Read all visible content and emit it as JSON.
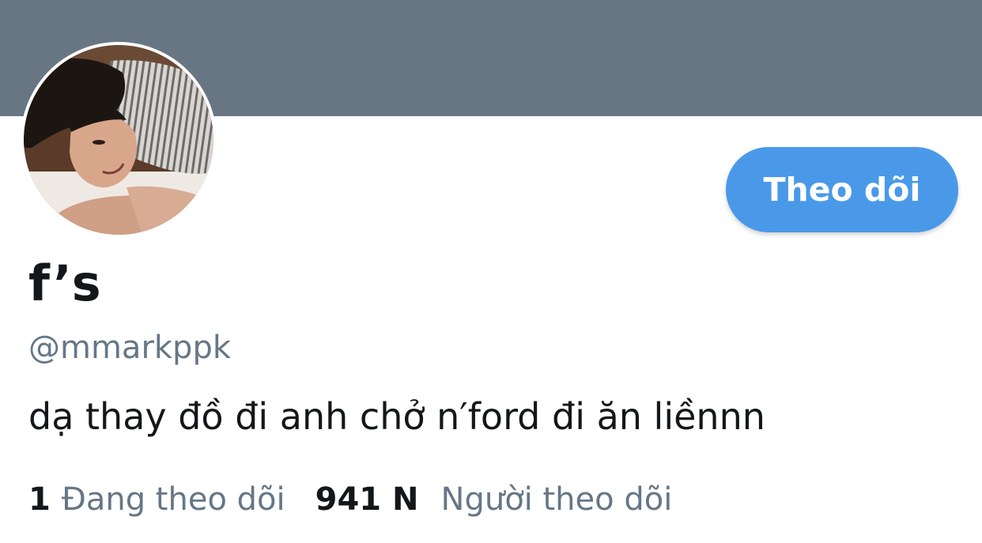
{
  "profile": {
    "display_name": "f’s",
    "handle": "@mmarkppk",
    "bio": "dạ thay đồ đi anh chở n′ford đi ăn liềnnn",
    "follow_button_label": "Theo dõi"
  },
  "stats": {
    "following_count": "1",
    "following_label": "Đang theo dõi",
    "followers_count": "941 N",
    "followers_label": "Người theo dõi"
  },
  "colors": {
    "banner": "#687684",
    "accent": "#4a99e9",
    "secondary_text": "#657786",
    "primary_text": "#14171a"
  }
}
